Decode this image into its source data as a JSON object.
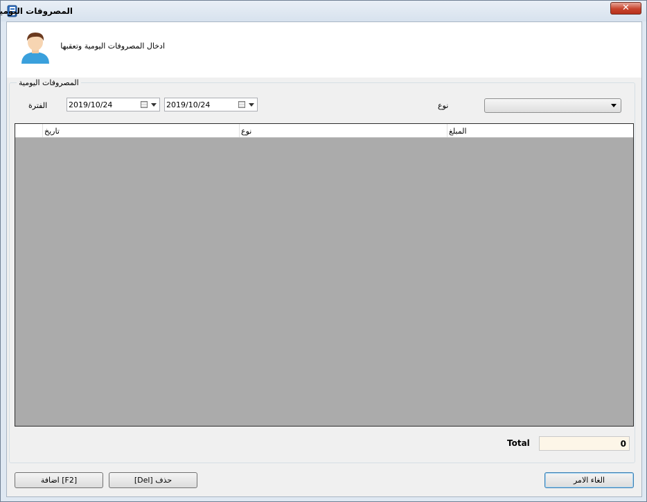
{
  "window": {
    "title": "المصروفات اليومية",
    "close_glyph": "✕"
  },
  "header": {
    "description": "ادخال المصروفات اليومية وتعقبها",
    "avatar_icon": "user-avatar-icon"
  },
  "group": {
    "label": "المصروفات اليومية",
    "period_label": "الفترة",
    "type_label": "نوع",
    "date_from": "2019/10/24",
    "date_to": "2019/10/24",
    "type_selected": ""
  },
  "grid": {
    "columns": [
      "المبلغ",
      "نوع",
      "تاريخ"
    ],
    "rows": []
  },
  "footer": {
    "total_label": "Total",
    "total_value": "0"
  },
  "buttons": {
    "add": "[F2] اضافة",
    "delete": "حذف [Del]",
    "cancel": "الغاء الامر"
  },
  "colors": {
    "grid_background": "#ababab",
    "total_background": "#fdf6e8",
    "close_button": "#c7442d"
  }
}
